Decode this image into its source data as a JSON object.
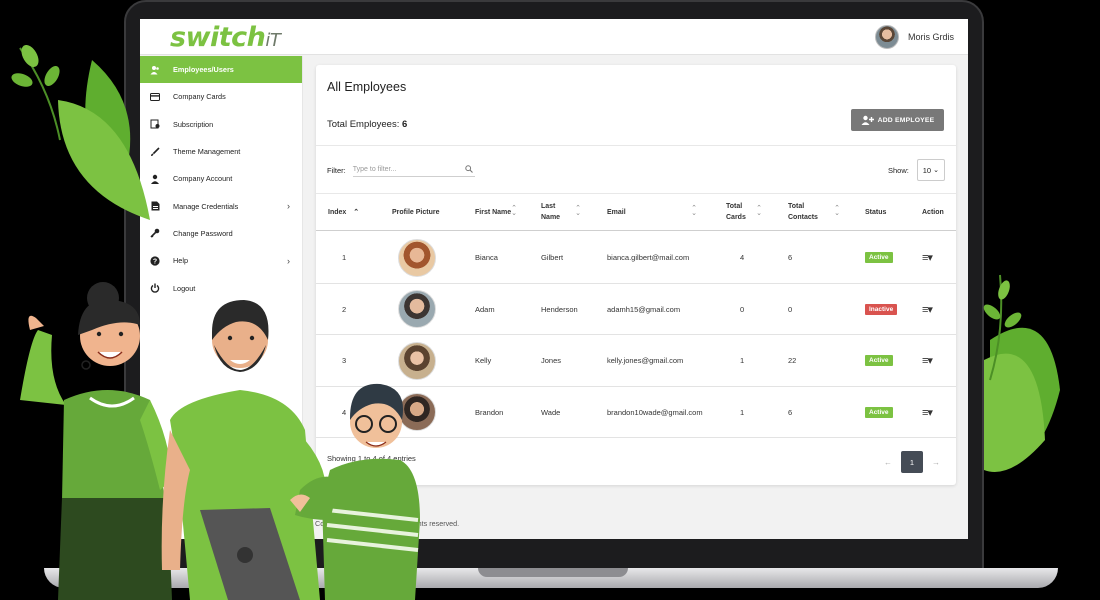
{
  "brand": {
    "name": "switch",
    "suffix": "iT"
  },
  "user": {
    "name": "Moris Grdis"
  },
  "sidebar": {
    "items": [
      {
        "label": "Employees/Users",
        "icon": "users-icon",
        "active": true
      },
      {
        "label": "Company Cards",
        "icon": "card-icon"
      },
      {
        "label": "Subscription",
        "icon": "subscription-icon"
      },
      {
        "label": "Theme Management",
        "icon": "brush-icon"
      },
      {
        "label": "Company Account",
        "icon": "person-icon"
      },
      {
        "label": "Manage Credentials",
        "icon": "file-icon",
        "expandable": true
      },
      {
        "label": "Change Password",
        "icon": "key-icon"
      },
      {
        "label": "Help",
        "icon": "help-icon",
        "expandable": true
      },
      {
        "label": "Logout",
        "icon": "power-icon"
      }
    ]
  },
  "main": {
    "title": "All Employees",
    "total_label": "Total Employees:",
    "total_value": "6",
    "add_button": "ADD EMPLOYEE",
    "filter_label": "Filter:",
    "filter_placeholder": "Type to filter...",
    "show_label": "Show:",
    "show_value": "10",
    "columns": [
      "Index",
      "Profile Picture",
      "First Name",
      "Last Name",
      "Email",
      "Total Cards",
      "Total Contacts",
      "Status",
      "Action"
    ],
    "rows": [
      {
        "index": "1",
        "first": "Bianca",
        "last": "Gilbert",
        "email": "bianca.gilbert@mail.com",
        "cards": "4",
        "contacts": "6",
        "status": "Active"
      },
      {
        "index": "2",
        "first": "Adam",
        "last": "Henderson",
        "email": "adamh15@gmail.com",
        "cards": "0",
        "contacts": "0",
        "status": "Inactive"
      },
      {
        "index": "3",
        "first": "Kelly",
        "last": "Jones",
        "email": "kelly.jones@gmail.com",
        "cards": "1",
        "contacts": "22",
        "status": "Active"
      },
      {
        "index": "4",
        "first": "Brandon",
        "last": "Wade",
        "email": "brandon10wade@gmail.com",
        "cards": "1",
        "contacts": "6",
        "status": "Active"
      }
    ],
    "showing_text": "Showing 1 to 4 of 4 entries",
    "page_prev": "←",
    "page_current": "1",
    "page_next": "→"
  },
  "copyright": "Copyright © switchiT LLC. All rights reserved.",
  "colors": {
    "brand": "#7cc242",
    "active": "#7cc242",
    "inactive": "#d9534f",
    "button": "#787878"
  }
}
